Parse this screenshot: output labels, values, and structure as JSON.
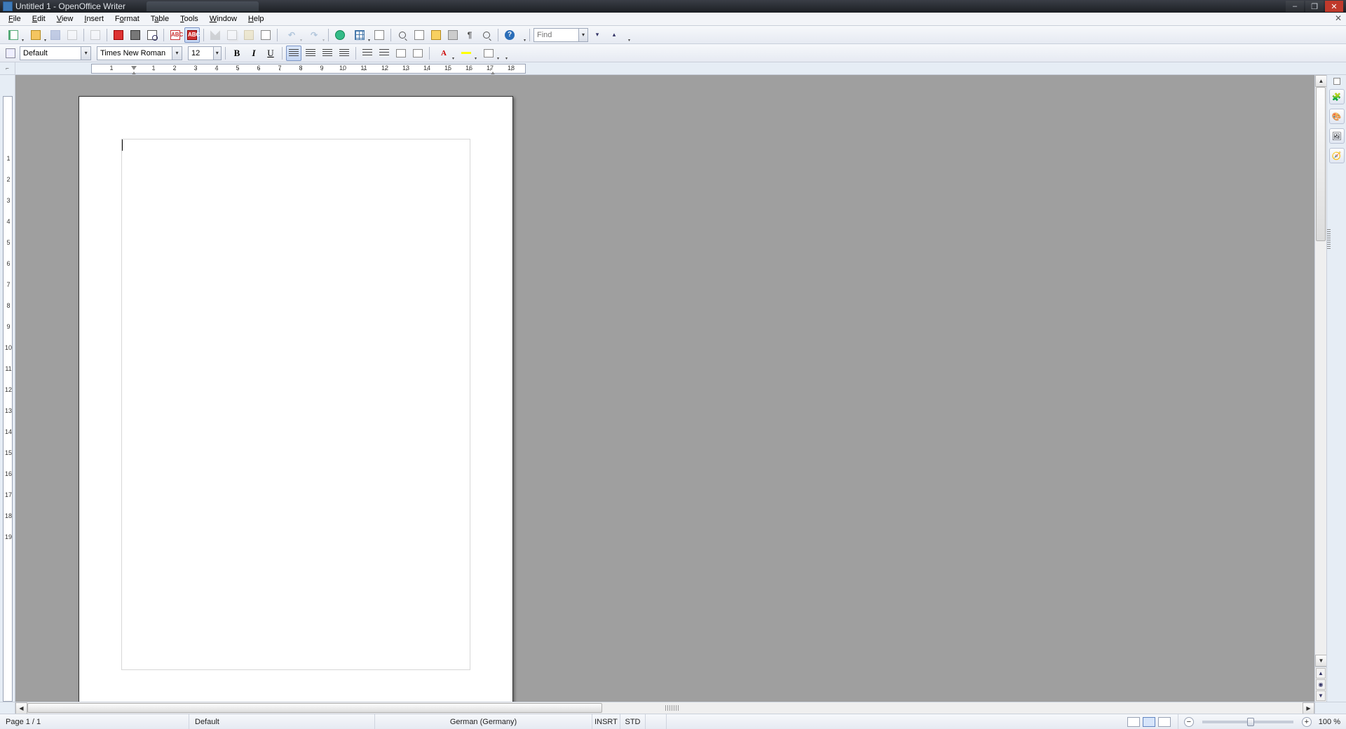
{
  "window": {
    "title": "Untitled 1 - OpenOffice Writer",
    "controls": {
      "min": "–",
      "max": "❐",
      "close": "✕"
    }
  },
  "menus": [
    "File",
    "Edit",
    "View",
    "Insert",
    "Format",
    "Table",
    "Tools",
    "Window",
    "Help"
  ],
  "find": {
    "placeholder": "Find"
  },
  "fmt": {
    "style": "Default",
    "font": "Times New Roman",
    "size": "12"
  },
  "ruler": {
    "h_numbers": [
      1,
      1,
      2,
      3,
      4,
      5,
      6,
      7,
      8,
      9,
      10,
      11,
      12,
      13,
      14,
      15,
      16,
      17,
      18
    ],
    "v_numbers": [
      1,
      2,
      3,
      4,
      5,
      6,
      7,
      8,
      9,
      10,
      11,
      12,
      13,
      14,
      15,
      16,
      17,
      18,
      19
    ]
  },
  "status": {
    "page": "Page 1 / 1",
    "style": "Default",
    "lang": "German (Germany)",
    "insrt": "INSRT",
    "std": "STD",
    "zoom": "100 %"
  },
  "toolbar1": {
    "abc": "ABC",
    "abc2": "ABC",
    "pilcrow": "¶",
    "q": "?",
    "undo": "↶",
    "redo": "↷",
    "down": "▾",
    "up": "▴"
  },
  "toolbar2": {
    "b": "B",
    "i": "I",
    "u": "U",
    "a": "A"
  }
}
